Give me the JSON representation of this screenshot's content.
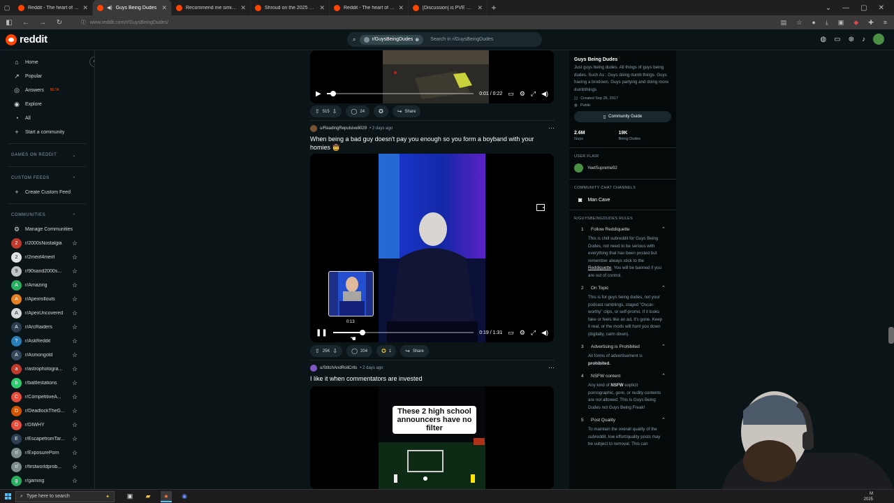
{
  "browser": {
    "tabs": [
      {
        "title": "Reddit - The heart of the intern",
        "active": false
      },
      {
        "title": "Guys Being Dudes",
        "active": true
      },
      {
        "title": "Recommend me similar series |",
        "active": false
      },
      {
        "title": "Shroud on the 2025 Game of th",
        "active": false
      },
      {
        "title": "Reddit - The heart of the intern",
        "active": false
      },
      {
        "title": "[Discussion] is PVE worth playin",
        "active": false
      }
    ],
    "new_tab": "+",
    "url": "www.reddit.com/r/GuysBeingDudes/"
  },
  "header": {
    "logo_text": "reddit",
    "search_chip": "r/GuysBeingDudes",
    "search_placeholder": "Search in r/GuysBeingDudes"
  },
  "left_nav": {
    "items": [
      {
        "label": "Home",
        "icon": "home-icon",
        "glyph": "⌂"
      },
      {
        "label": "Popular",
        "icon": "popular-icon",
        "glyph": "↗"
      },
      {
        "label": "Answers",
        "icon": "answers-icon",
        "glyph": "◎",
        "badge": "BETA"
      },
      {
        "label": "Explore",
        "icon": "explore-icon",
        "glyph": "◉"
      },
      {
        "label": "All",
        "icon": "all-icon",
        "glyph": "◔"
      },
      {
        "label": "Start a community",
        "icon": "plus-icon",
        "glyph": "+"
      }
    ],
    "games_heading": "GAMES ON REDDIT",
    "custom_feeds_heading": "CUSTOM FEEDS",
    "create_custom_feed": "Create Custom Feed",
    "communities_heading": "COMMUNITIES",
    "manage_communities": "Manage Communities",
    "communities": [
      {
        "name": "r/2000sNostalgia",
        "color": "#c0392b",
        "letter": "2"
      },
      {
        "name": "r/2meirl4meirl",
        "color": "#dfe3e6",
        "letter": "2"
      },
      {
        "name": "r/90sand2000s...",
        "color": "#bdc3c7",
        "letter": "9"
      },
      {
        "name": "r/Amazing",
        "color": "#27ae60",
        "letter": "A"
      },
      {
        "name": "r/Apexrollouts",
        "color": "#e67e22",
        "letter": "A"
      },
      {
        "name": "r/ApexUncovered",
        "color": "#d7dadc",
        "letter": "A"
      },
      {
        "name": "r/ArcRaiders",
        "color": "#2c3e50",
        "letter": "A"
      },
      {
        "name": "r/AskReddit",
        "color": "#2980b9",
        "letter": "?"
      },
      {
        "name": "r/Asmongold",
        "color": "#34495e",
        "letter": "A"
      },
      {
        "name": "r/astrophotogra...",
        "color": "#c0392b",
        "letter": "a"
      },
      {
        "name": "r/battlestations",
        "color": "#2ecc71",
        "letter": "b"
      },
      {
        "name": "r/CompetitiveA...",
        "color": "#e74c3c",
        "letter": "C"
      },
      {
        "name": "r/DeadlockTheG...",
        "color": "#d35400",
        "letter": "D"
      },
      {
        "name": "r/DIWHY",
        "color": "#e74c3c",
        "letter": "D"
      },
      {
        "name": "r/EscapefromTar...",
        "color": "#2c3e50",
        "letter": "E"
      },
      {
        "name": "r/ExposurePorn",
        "color": "#7f8c8d",
        "letter": "r/"
      },
      {
        "name": "r/firstworldprob...",
        "color": "#7f8c8d",
        "letter": "r/"
      },
      {
        "name": "r/gaming",
        "color": "#27ae60",
        "letter": "g"
      }
    ]
  },
  "feed": {
    "post1": {
      "time": "0:01 / 0:22",
      "progress": 0.045,
      "votes": "515",
      "comments": "24",
      "share": "Share"
    },
    "post2": {
      "author": "u/ReadingRepulsive8029",
      "age": "• 2 days ago",
      "title": "When being a bad guy doesn't pay you enough so you form a boyband with your homies 🤠",
      "time": "0:19 / 1:31",
      "progress": 0.21,
      "hover_time": "0:13",
      "votes": "25K",
      "comments": "204",
      "awards": "1",
      "share": "Share"
    },
    "post3": {
      "author": "u/StitchAndRollCrits",
      "age": "• 2 days ago",
      "title": "I like it when commentators are invested",
      "caption": "These 2 high school announcers have no filter"
    }
  },
  "right_sidebar": {
    "title": "Guys Being Dudes",
    "description": "Just guys being dudes. All things of guys being dudes. Such As : Guys doing dumb things. Guys having a brodown. Guys partying and doing more dumbthings",
    "created": "Created Sep 26, 2017",
    "visibility": "Public",
    "guide_button": "Community Guide",
    "members_count": "2.6M",
    "members_label": "Guys",
    "online_count": "19K",
    "online_label": "Being Dudes",
    "user_flair_heading": "USER FLAIR",
    "user_flair_name": "YeetSupreme92",
    "chat_heading": "COMMUNITY CHAT CHANNELS",
    "chat_channel": "Man Cave",
    "rules_heading": "R/GUYSBEINGDUDES RULES",
    "rules": [
      {
        "num": "1",
        "title": "Follow Reddiquette",
        "body": "This is chill subreddit for Guys Being Dudes, not need to be serious with everything that has been posted but remember always stick to the",
        "link": "Reddiquette",
        "body_after": ". You will be banned if you are out of control."
      },
      {
        "num": "2",
        "title": "On Topic",
        "body": "This is for guys being dudes, not your podcast ramblings, staged \"Oscar-worthy\" clips, or self-promo. If it looks fake or feels like an ad, it's gone. Keep it real, or the mods will hunt you down (digitally, calm down).",
        "link": "",
        "body_after": ""
      },
      {
        "num": "3",
        "title": "Advertising is Prohibited",
        "body": "All forms of advertisement is",
        "link": "",
        "body_after": "",
        "strong": "prohibited."
      },
      {
        "num": "4",
        "title": "NSFW content",
        "body": "Any kind of",
        "strong": "NSFW",
        "body_after": " explicit pornographic, gore, or nudity contents are not allowed. This is Guys Being Dudes not Guys Being Freak!",
        "link": ""
      },
      {
        "num": "5",
        "title": "Post Quality",
        "body": "To maintain the overall quality of the subreddit, low effort/quality posts may be subject to removal. This can",
        "link": "",
        "body_after": ""
      }
    ]
  },
  "taskbar": {
    "search_placeholder": "Type here to search",
    "clock_line1": "M",
    "clock_line2": "2025"
  }
}
